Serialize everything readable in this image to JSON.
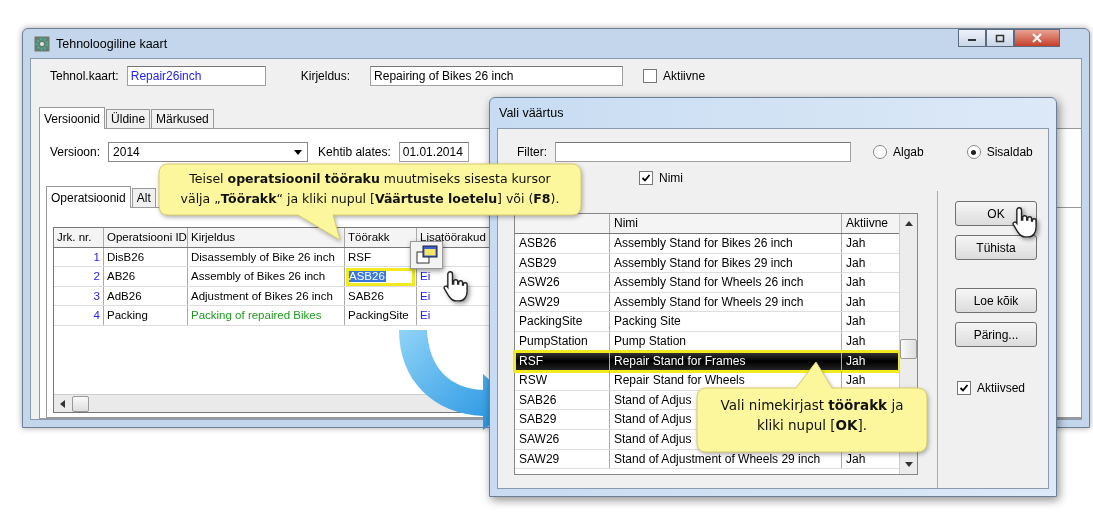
{
  "main_window": {
    "title": "Tehnoloogiline kaart",
    "header_fields": [
      {
        "label": "Tehnol.kaart:",
        "value": "Repair26inch",
        "kind": "code"
      },
      {
        "label": "Kirjeldus:",
        "value": "Repairing of Bikes 26 inch",
        "kind": "text"
      }
    ],
    "active_checkbox": {
      "label": "Aktiivne",
      "checked": false
    },
    "tabs": [
      {
        "label": "Versioonid",
        "selected": true
      },
      {
        "label": "Üldine",
        "selected": false
      },
      {
        "label": "Märkused",
        "selected": false
      }
    ],
    "version": {
      "label": "Versioon:",
      "value": "2014"
    },
    "valid_from": {
      "label": "Kehtib alates:",
      "value": "01.01.2014"
    },
    "sub_tabs": [
      {
        "label": "Operatsioonid",
        "selected": true
      },
      {
        "label": "Alt",
        "selected": false
      }
    ],
    "table": {
      "columns": [
        "Jrk. nr.",
        "Operatsiooni ID",
        "Kirjeldus",
        "Töörakk",
        "Lisatöörakud"
      ],
      "rows": [
        {
          "nr": "1",
          "op_id": "DisB26",
          "description": "Disassembly of Bike 26 inch",
          "color": "#000000",
          "workcell": "RSF",
          "selected": false
        },
        {
          "nr": "2",
          "op_id": "AB26",
          "description": "Assembly of Bikes 26 inch",
          "color": "#000000",
          "workcell": "ASB26",
          "selected": true,
          "extra": "Ei"
        },
        {
          "nr": "3",
          "op_id": "AdB26",
          "description": "Adjustment of Bikes 26 inch",
          "color": "#000000",
          "workcell": "SAB26",
          "selected": false,
          "extra": "Ei"
        },
        {
          "nr": "4",
          "op_id": "Packing",
          "description": "Packing of repaired Bikes",
          "color": "#1f9a1f",
          "workcell": "PackingSite",
          "selected": false,
          "extra": "Ei"
        }
      ]
    }
  },
  "dialog": {
    "title": "Vali väärtus",
    "filter": {
      "label": "Filter:"
    },
    "radios": [
      {
        "label": "Algab",
        "selected": false
      },
      {
        "label": "Sisaldab",
        "selected": true
      }
    ],
    "name_checkbox": {
      "label": "Nimi",
      "checked": true
    },
    "columns": [
      "Nimi",
      "Aktiivne"
    ],
    "rows": [
      {
        "id": "ASB26",
        "name": "Assembly Stand for Bikes 26 inch",
        "active": "Jah",
        "selected": false
      },
      {
        "id": "ASB29",
        "name": "Assembly Stand for Bikes 29 inch",
        "active": "Jah",
        "selected": false
      },
      {
        "id": "ASW26",
        "name": "Assembly Stand for Wheels 26 inch",
        "active": "Jah",
        "selected": false
      },
      {
        "id": "ASW29",
        "name": "Assembly Stand for Wheels 29 inch",
        "active": "Jah",
        "selected": false
      },
      {
        "id": "PackingSite",
        "name": "Packing Site",
        "active": "Jah",
        "selected": false
      },
      {
        "id": "PumpStation",
        "name": "Pump Station",
        "active": "Jah",
        "selected": false
      },
      {
        "id": "RSF",
        "name": "Repair Stand for Frames",
        "active": "Jah",
        "selected": true
      },
      {
        "id": "RSW",
        "name": "Repair Stand for Wheels",
        "active": "Jah",
        "selected": false
      },
      {
        "id": "SAB26",
        "name": "Stand of Adjus",
        "selected": false
      },
      {
        "id": "SAB29",
        "name": "Stand of Adjus",
        "selected": false
      },
      {
        "id": "SAW26",
        "name": "Stand of Adjus",
        "selected": false
      },
      {
        "id": "SAW29",
        "name": "Stand of Adjustment of Wheels 29 inch",
        "active": "Jah",
        "selected": false
      }
    ],
    "buttons": [
      "OK",
      "Tühista",
      "Loe kõik",
      "Päring..."
    ],
    "active_checkbox": {
      "label": "Aktiivsed",
      "checked": true
    }
  },
  "callouts": [
    "Teisel **operatsioonil tööraku** muutmiseks sisesta kursor\nvälja „**Töörakk**“ ja kliki nupul [**Väärtuste loetelu**] või (**F8**).",
    "Vali nimekirjast **töörakk** ja\nkliki nupul [**OK**]."
  ]
}
